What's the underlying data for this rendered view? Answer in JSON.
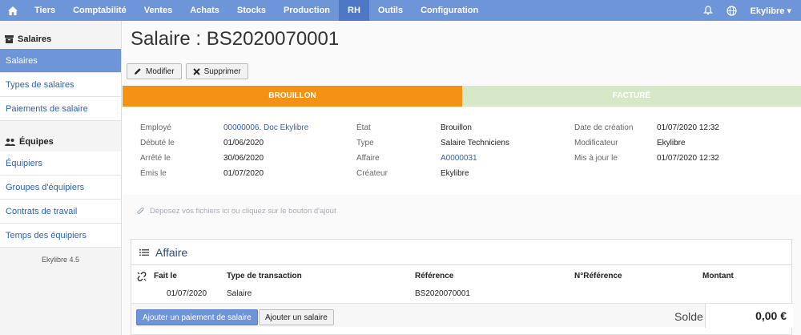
{
  "topbar": {
    "home_icon": "home-icon",
    "items": [
      "Tiers",
      "Comptabilité",
      "Ventes",
      "Achats",
      "Stocks",
      "Production",
      "RH",
      "Outils",
      "Configuration"
    ],
    "active": "RH",
    "user": "Ekylibre",
    "colors": {
      "bar": "#6f95d9",
      "active": "#4e77c6"
    }
  },
  "sidebar": {
    "salaires_header": "Salaires",
    "salaires_items": [
      "Salaires",
      "Types de salaires",
      "Paiements de salaire"
    ],
    "equipes_header": "Équipes",
    "equipes_items": [
      "Équipiers",
      "Groupes d'équipiers",
      "Contrats de travail",
      "Temps des équipiers"
    ],
    "version": "Ekylibre 4.5"
  },
  "page": {
    "title": "Salaire : BS2020070001",
    "modify_label": "Modifier",
    "delete_label": "Supprimer"
  },
  "status": {
    "brouillon": "BROUILLON",
    "facture": "FACTURÉ",
    "colors": {
      "active": "#f59114",
      "inactive": "#d6e8c8"
    }
  },
  "details": {
    "employe_label": "Employé",
    "employe_value": "00000006. Doc Ekylibre",
    "debute_label": "Débuté le",
    "debute_value": "01/06/2020",
    "arrete_label": "Arrêté le",
    "arrete_value": "30/06/2020",
    "emis_label": "Émis le",
    "emis_value": "01/07/2020",
    "etat_label": "État",
    "etat_value": "Brouillon",
    "type_label": "Type",
    "type_value": "Salaire Techniciens",
    "affaire_label": "Affaire",
    "affaire_value": "A0000031",
    "createur_label": "Créateur",
    "createur_value": "Ekylibre",
    "creation_label": "Date de création",
    "creation_value": "01/07/2020 12:32",
    "modificateur_label": "Modificateur",
    "modificateur_value": "Ekylibre",
    "maj_label": "Mis à jour le",
    "maj_value": "01/07/2020 12:32"
  },
  "dropzone": "Déposez vos fichiers ici ou cliquez sur le bouton d'ajout",
  "affaire": {
    "title": "Affaire",
    "columns": [
      "Fait le",
      "Type de transaction",
      "Référence",
      "N°Référence",
      "Montant"
    ],
    "row": {
      "date": "01/07/2020",
      "type": "Salaire",
      "reference": "BS2020070001"
    },
    "add_payment": "Ajouter un paiement de salaire",
    "add_salary": "Ajouter un salaire",
    "solde_label": "Solde",
    "solde_value": "0,00 €"
  }
}
